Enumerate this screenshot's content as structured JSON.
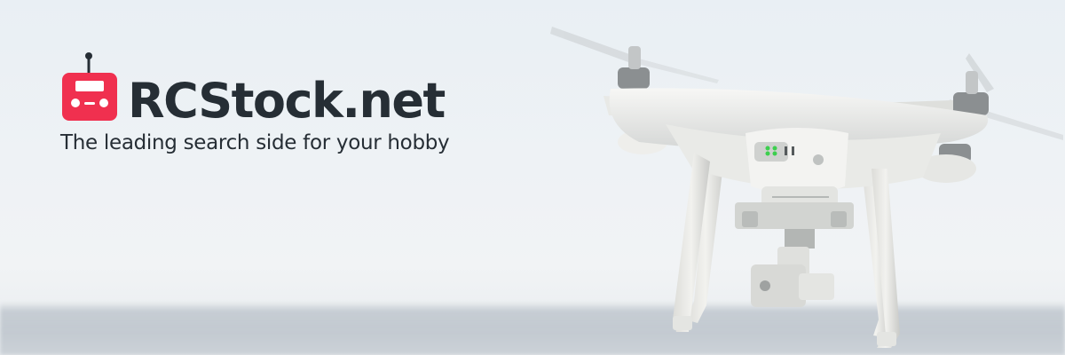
{
  "brand": {
    "name": "RCStock.net",
    "tagline": "The leading search side for your hobby",
    "accent_color": "#f0304f",
    "text_color": "#262e35",
    "logo_icon": "rc-transmitter-icon"
  },
  "hero_image": {
    "subject": "drone-icon",
    "status_lights_color": "#3ccf4e"
  }
}
